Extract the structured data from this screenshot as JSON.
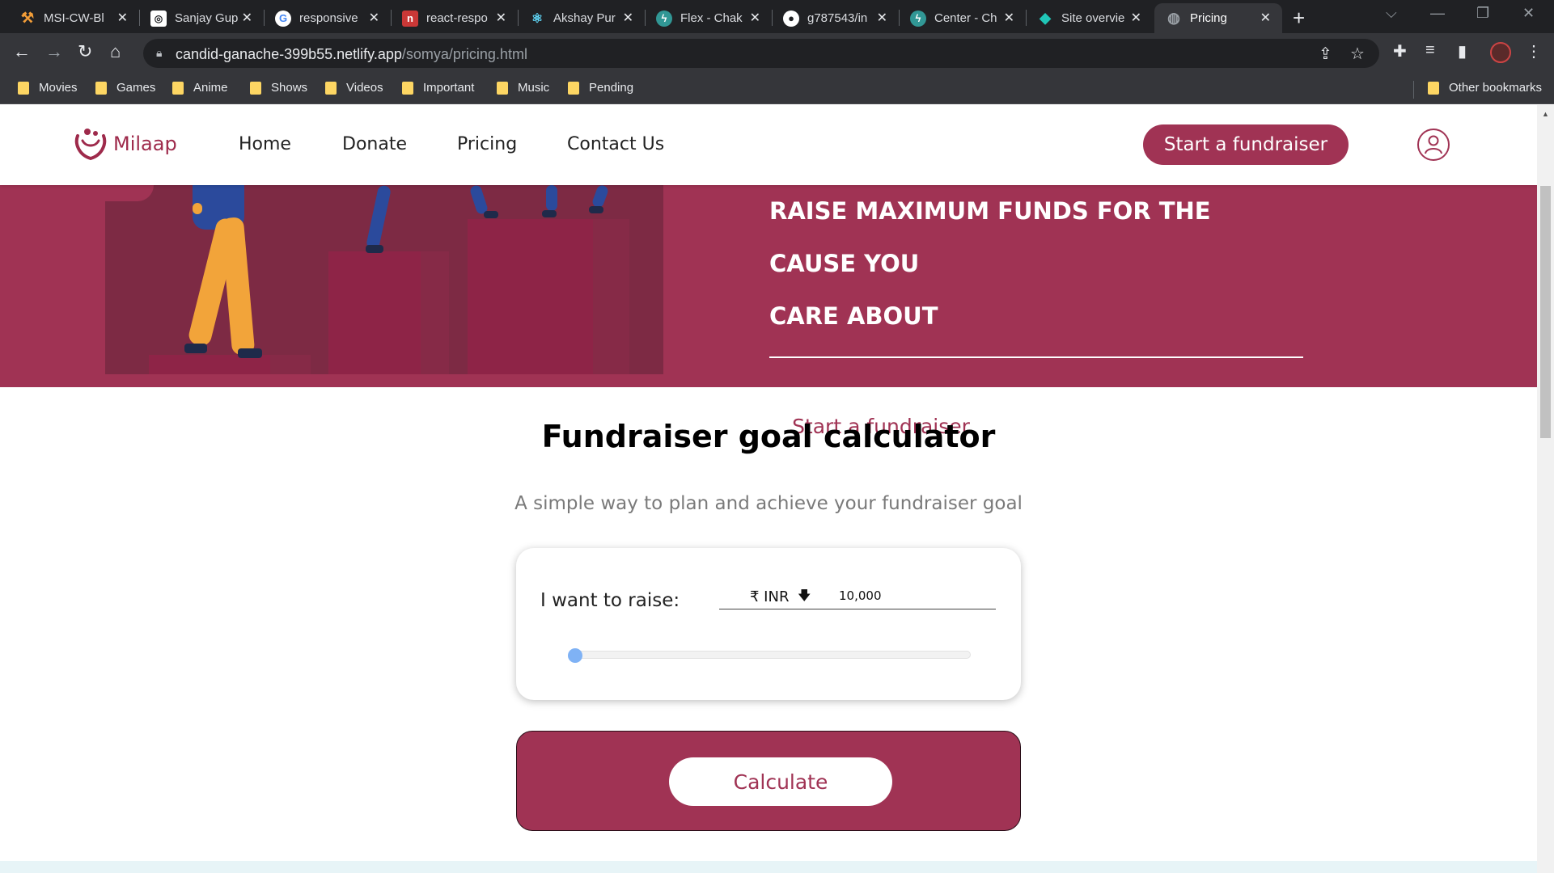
{
  "browser": {
    "tabs": [
      {
        "title": "MSI-CW-Bl",
        "icon": "tools-icon",
        "color": "#f29d38"
      },
      {
        "title": "Sanjay Gup",
        "icon": "site-icon",
        "color": "#ffffff"
      },
      {
        "title": "responsive",
        "icon": "google-icon",
        "color": "#4285f4"
      },
      {
        "title": "react-respo",
        "icon": "npm-icon",
        "color": "#cb3837"
      },
      {
        "title": "Akshay Pur",
        "icon": "react-icon",
        "color": "#61dafb"
      },
      {
        "title": "Flex - Chak",
        "icon": "chakra-icon",
        "color": "#319795"
      },
      {
        "title": "g787543/in",
        "icon": "github-icon",
        "color": "#ffffff"
      },
      {
        "title": "Center - Ch",
        "icon": "chakra-icon",
        "color": "#319795"
      },
      {
        "title": "Site overvie",
        "icon": "netlify-icon",
        "color": "#20c6b7"
      },
      {
        "title": "Pricing",
        "icon": "globe-icon",
        "color": "#9aa0a6"
      }
    ],
    "url_host": "candid-ganache-399b55.netlify.app",
    "url_path": "/somya/pricing.html",
    "bookmarks": [
      "Movies",
      "Games",
      "Anime",
      "Shows",
      "Videos",
      "Important",
      "Music",
      "Pending"
    ],
    "other_bookmarks": "Other bookmarks"
  },
  "nav": {
    "logo": "Milaap",
    "links": [
      "Home",
      "Donate",
      "Pricing",
      "Contact Us"
    ],
    "cta": "Start a fundraiser"
  },
  "hero": {
    "heading_line1": "RAISE MAXIMUM FUNDS FOR THE CAUSE YOU",
    "heading_line2": "CARE ABOUT",
    "button": "Start a fundraiser"
  },
  "calculator": {
    "title": "Fundraiser goal calculator",
    "subtitle": "A simple way to plan and achieve your fundraiser goal",
    "raise_label": "I want to raise:",
    "currency": "₹ INR",
    "amount": "10,000",
    "slider_fraction": 0.0,
    "calculate_button": "Calculate"
  },
  "colors": {
    "brand": "#a03354",
    "slider_thumb": "#7fb2f5"
  }
}
